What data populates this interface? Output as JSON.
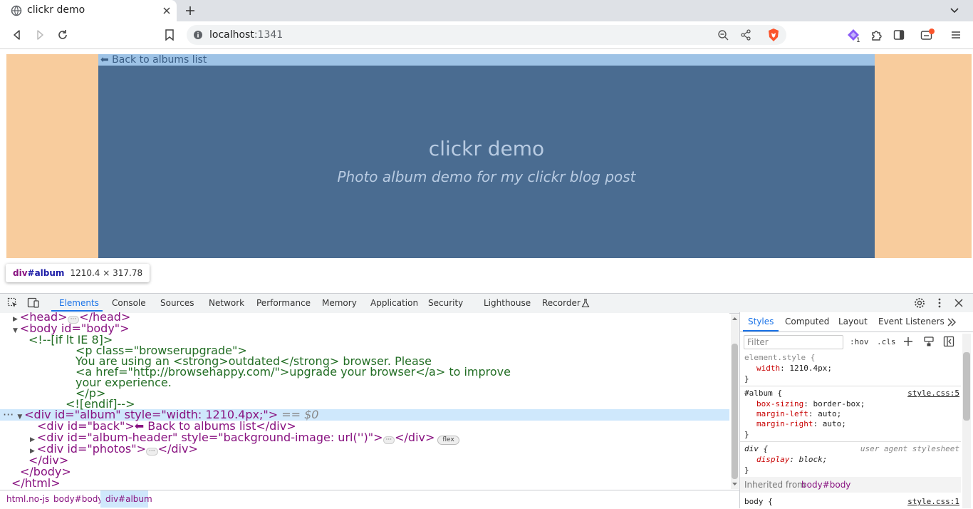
{
  "browser": {
    "tab_title": "clickr demo",
    "url_host": "localhost",
    "url_port": ":1341",
    "notification_count": "1"
  },
  "page": {
    "back_link": "⬅ Back to albums list",
    "header_title": "clickr demo",
    "header_subtitle": "Photo album demo for my clickr blog post",
    "colors": {
      "page_bg": "#f8cc9d",
      "album_bg": "#4a6c91",
      "back_bg": "#9ec3e6"
    }
  },
  "tooltip": {
    "tag": "div",
    "id": "#album",
    "dims": "1210.4 × 317.78"
  },
  "devtools": {
    "tabs": [
      "Elements",
      "Console",
      "Sources",
      "Network",
      "Performance",
      "Memory",
      "Application",
      "Security",
      "Lighthouse",
      "Recorder"
    ],
    "dom": {
      "head": "<head>",
      "head_close": "</head>",
      "body_open": "<body id=\"body\">",
      "comment_open": "<!--[if lt IE 8]>",
      "p_open": "<p class=\"browserupgrade\">",
      "line_outdated": "You are using an <strong>outdated</strong> browser. Please",
      "line_link": "<a href=\"http://browsehappy.com/\">upgrade your browser</a> to improve",
      "line_experience": "your experience.",
      "p_close": "</p>",
      "comment_close": "<![endif]-->",
      "album_tag": "<div id=\"album\" style=\"width: 1210.4px;\">",
      "album_marker": "== $0",
      "back_line": "<div id=\"back\">⬅ Back to albums list</div>",
      "header_line": "<div id=\"album-header\" style=\"background-image: url('')\">",
      "header_close": "</div>",
      "flex_badge": "flex",
      "photos_open": "<div id=\"photos\">",
      "photos_close": "</div>",
      "div_close": "</div>",
      "body_close": "</body>",
      "html_close": "</html>"
    },
    "breadcrumbs": [
      "html.no-js",
      "body#body",
      "div#album"
    ],
    "styles": {
      "tabs": [
        "Styles",
        "Computed",
        "Layout",
        "Event Listeners"
      ],
      "filter_placeholder": "Filter",
      "hov": ":hov",
      "cls": ".cls",
      "element_style_selector": "element.style {",
      "element_style_prop": "width",
      "element_style_val": "1210.4px;",
      "album_selector": "#album {",
      "album_source": "style.css:5",
      "album_props": [
        {
          "name": "box-sizing",
          "value": "border-box;"
        },
        {
          "name": "margin-left",
          "value": "auto;"
        },
        {
          "name": "margin-right",
          "value": "auto;"
        }
      ],
      "div_selector": "div {",
      "div_source": "user agent stylesheet",
      "div_prop": "display",
      "div_val": "block;",
      "close_brace": "}",
      "inherited_label": "Inherited from",
      "inherited_from": "body#body",
      "body_selector": "body {",
      "body_source": "style.css:1"
    }
  }
}
